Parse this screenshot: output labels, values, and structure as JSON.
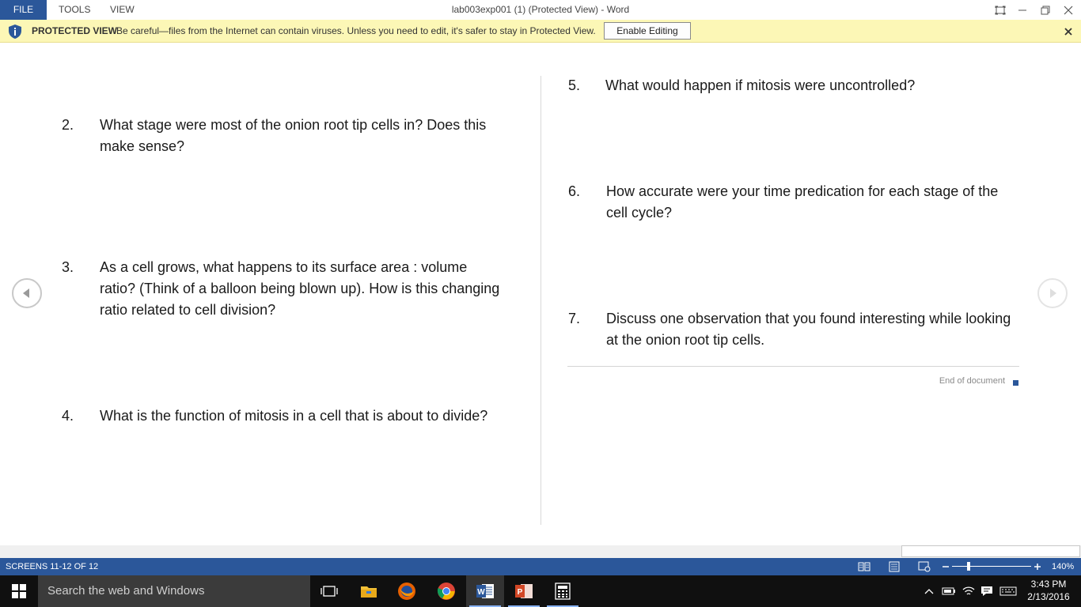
{
  "titlebar": {
    "menu": [
      "FILE",
      "TOOLS",
      "VIEW"
    ],
    "title": "lab003exp001 (1) (Protected View) - Word"
  },
  "protected_bar": {
    "title": "PROTECTED VIEW",
    "message": "Be careful—files from the Internet can contain viruses. Unless you need to edit, it's safer to stay in Protected View.",
    "button": "Enable Editing"
  },
  "document": {
    "questions": [
      {
        "num": "2.",
        "text": "What stage were most of the onion root tip cells in?  Does this make sense?"
      },
      {
        "num": "3.",
        "text": "As a cell grows, what happens to its surface area : volume ratio? (Think of a balloon being blown up). How is this changing ratio related to cell division?"
      },
      {
        "num": "4.",
        "text": "What is the function of mitosis in a cell that is about to divide?"
      },
      {
        "num": "5.",
        "text": "What would happen if mitosis were uncontrolled?"
      },
      {
        "num": "6.",
        "text": "How accurate were your time predication for each stage of the cell cycle?"
      },
      {
        "num": "7.",
        "text": "Discuss one observation that you found interesting while looking at the onion root tip cells."
      }
    ],
    "end_of_document": "End of document"
  },
  "statusbar": {
    "screens": "SCREENS 11-12 OF 12",
    "zoom": "140%",
    "zoom_level": 140
  },
  "taskbar": {
    "search_placeholder": "Search the web and Windows",
    "apps": [
      "task-view-icon",
      "file-explorer-icon",
      "firefox-icon",
      "chrome-icon",
      "word-icon",
      "powerpoint-icon",
      "calculator-icon"
    ],
    "time": "3:43 PM",
    "date": "2/13/2016"
  },
  "colors": {
    "accent": "#2b579a",
    "protected_bar": "#fcf7b6",
    "taskbar": "#101010"
  }
}
